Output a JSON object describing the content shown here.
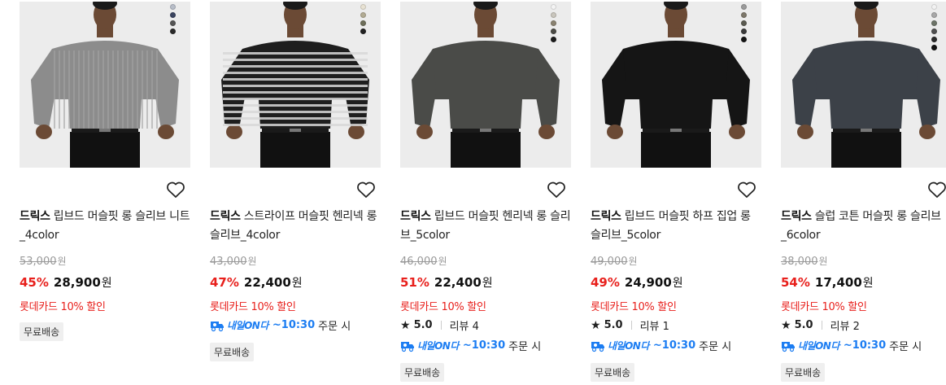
{
  "products": [
    {
      "brand": "드릭스",
      "name": "립브드 머슬핏 롱 슬리브 니트_4color",
      "original_price": "53,000",
      "currency": "원",
      "discount": "45%",
      "sale_price": "28,900",
      "card_offer": "롯데카드 10% 할인",
      "rating": null,
      "reviews": null,
      "delivery": null,
      "badge": "무료배송",
      "swatches": [
        "#b7bdc8",
        "#3a4460",
        "#555555",
        "#2a2a2a"
      ],
      "shirt_color": "#8c8c8c",
      "shirt_pattern": "knit"
    },
    {
      "brand": "드릭스",
      "name": "스트라이프 머슬핏 헨리넥 롱 슬리브_4color",
      "original_price": "43,000",
      "currency": "원",
      "discount": "47%",
      "sale_price": "22,400",
      "card_offer": "롯데카드 10% 할인",
      "rating": null,
      "reviews": null,
      "delivery": {
        "label": "내일ON다",
        "time": "~10:30",
        "suffix": "주문 시"
      },
      "badge": "무료배송",
      "swatches": [
        "#e8e2d3",
        "#b2ab93",
        "#6e6f5a",
        "#222222"
      ],
      "shirt_color": "#1e1e1e",
      "shirt_pattern": "stripe"
    },
    {
      "brand": "드릭스",
      "name": "립브드 머슬핏 헨리넥 롱 슬리브_5color",
      "original_price": "46,000",
      "currency": "원",
      "discount": "51%",
      "sale_price": "22,400",
      "card_offer": "롯데카드 10% 할인",
      "rating": "5.0",
      "reviews": "리뷰 4",
      "delivery": {
        "label": "내일ON다",
        "time": "~10:30",
        "suffix": "주문 시"
      },
      "badge": "무료배송",
      "swatches": [
        "#f4f4f4",
        "#c9c6bd",
        "#8a8270",
        "#4b4a45",
        "#1c1c1c"
      ],
      "shirt_color": "#4a4b48",
      "shirt_pattern": "plain"
    },
    {
      "brand": "드릭스",
      "name": "립브드 머슬핏 하프 집업 롱 슬리브_5color",
      "original_price": "49,000",
      "currency": "원",
      "discount": "49%",
      "sale_price": "24,900",
      "card_offer": "롯데카드 10% 할인",
      "rating": "5.0",
      "reviews": "리뷰 1",
      "delivery": {
        "label": "내일ON다",
        "time": "~10:30",
        "suffix": "주문 시"
      },
      "badge": "무료배송",
      "swatches": [
        "#9a9a9a",
        "#7d776a",
        "#5a5a50",
        "#3a3a3a",
        "#141414"
      ],
      "shirt_color": "#151515",
      "shirt_pattern": "plain"
    },
    {
      "brand": "드릭스",
      "name": "슬럽 코튼 머슬핏 롱 슬리브_6color",
      "original_price": "38,000",
      "currency": "원",
      "discount": "54%",
      "sale_price": "17,400",
      "card_offer": "롯데카드 10% 할인",
      "rating": "5.0",
      "reviews": "리뷰 2",
      "delivery": {
        "label": "내일ON다",
        "time": "~10:30",
        "suffix": "주문 시"
      },
      "badge": "무료배송",
      "swatches": [
        "#f2f2f2",
        "#a7a7a7",
        "#6d7468",
        "#4f4f4f",
        "#2b2b2b",
        "#111111"
      ],
      "shirt_color": "#3c4148",
      "shirt_pattern": "plain"
    }
  ],
  "colors": {
    "discount": "#e8201c",
    "delivery_blue": "#1c7df2",
    "image_bg": "#ececec"
  }
}
